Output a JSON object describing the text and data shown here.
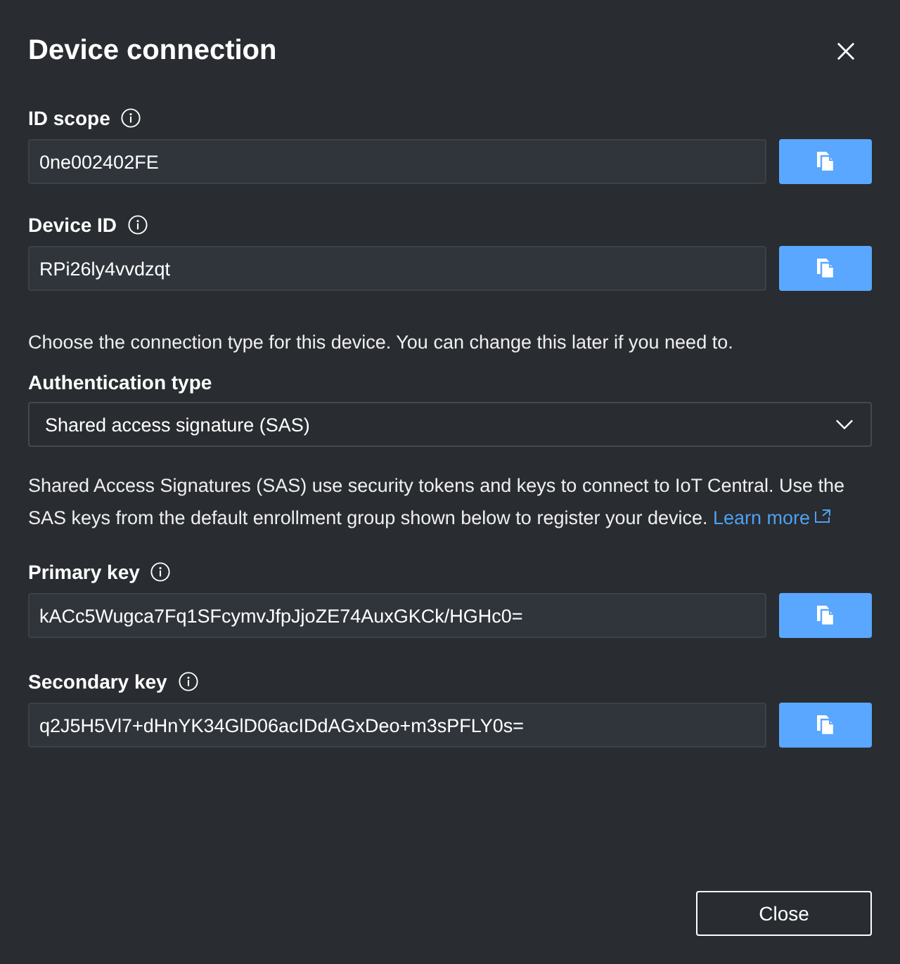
{
  "title": "Device connection",
  "id_fields": [
    {
      "label": "ID scope",
      "value": "0ne002402FE"
    },
    {
      "label": "Device ID",
      "value": "RPi26ly4vvdzqt"
    }
  ],
  "connection_hint": "Choose the connection type for this device. You can change this later if you need to.",
  "authentication": {
    "label": "Authentication type",
    "value": "Shared access signature (SAS)"
  },
  "sas_info": {
    "text": "Shared Access Signatures (SAS) use security tokens and keys to connect to IoT Central. Use the SAS keys from the default enrollment group shown below to register your device.",
    "link": "Learn more"
  },
  "key_fields": [
    {
      "label": "Primary key",
      "value": "kACc5Wugca7Fq1SFcymvJfpJjoZE74AuxGKCk/HGHc0="
    },
    {
      "label": "Secondary key",
      "value": "q2J5H5Vl7+dHnYK34GlD06acIDdAGxDeo+m3sPFLY0s="
    }
  ],
  "buttons": [
    "Close"
  ]
}
